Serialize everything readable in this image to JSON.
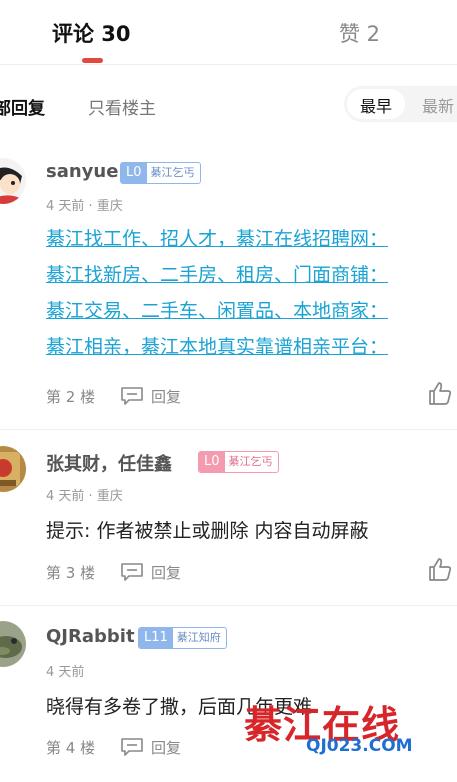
{
  "tabs": {
    "comments": "评论 30",
    "likes": "赞 2"
  },
  "filters": {
    "all": "部回复",
    "op_only": "只看楼主"
  },
  "sort": {
    "earliest": "最早",
    "newest": "最新"
  },
  "comments": [
    {
      "username": "sanyue",
      "level": "L0",
      "level_tag": "綦江乞丐",
      "meta": "4 天前 · 重庆",
      "links": [
        "綦江找工作、招人才，綦江在线招聘网：",
        "綦江找新房、二手房、租房、门面商铺：",
        "綦江交易、二手车、闲置品、本地商家：",
        "綦江相亲，綦江本地真实靠谱相亲平台："
      ],
      "floor": "第 2 楼",
      "reply": "回复"
    },
    {
      "username": "张其财，任佳鑫",
      "level": "L0",
      "level_tag": "綦江乞丐",
      "meta": "4 天前 · 重庆",
      "text": "提示: 作者被禁止或删除 内容自动屏蔽",
      "floor": "第 3 楼",
      "reply": "回复"
    },
    {
      "username": "QJRabbit",
      "level": "L11",
      "level_tag": "綦江知府",
      "meta": "4 天前",
      "text": "晓得有多卷了撒，后面几年更难",
      "floor": "第 4 楼",
      "reply": "回复"
    }
  ],
  "watermark": {
    "main": "綦江在线",
    "sub": "QJ023.COM"
  },
  "colors": {
    "accent": "#e04a3e",
    "link": "#1aa3d4",
    "level_blue": "#8fb7ec",
    "level_pink": "#f49bb0"
  }
}
